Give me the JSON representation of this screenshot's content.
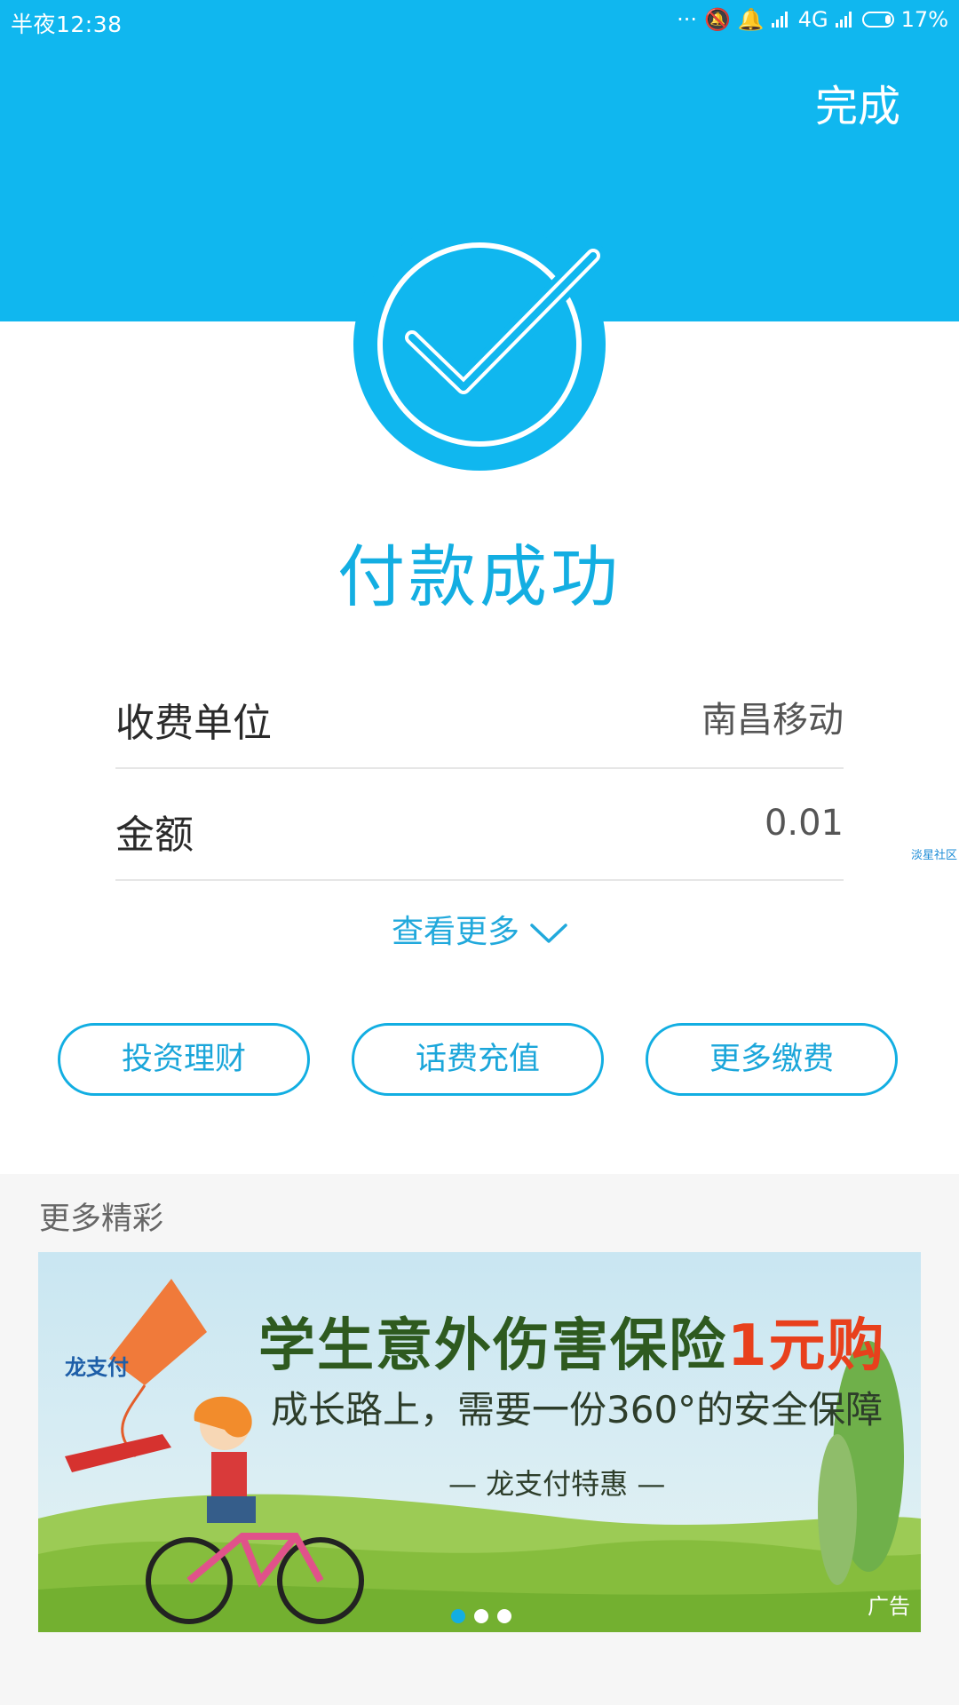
{
  "status_bar": {
    "time": "半夜12:38",
    "network": "4G",
    "battery": "17%"
  },
  "header": {
    "done_label": "完成"
  },
  "result": {
    "title": "付款成功",
    "rows": [
      {
        "label": "收费单位",
        "value": "南昌移动"
      },
      {
        "label": "金额",
        "value": "0.01"
      }
    ],
    "see_more": "查看更多"
  },
  "side_tag": "淡星社区",
  "actions": [
    {
      "label": "投资理财"
    },
    {
      "label": "话费充值"
    },
    {
      "label": "更多缴费"
    }
  ],
  "more": {
    "title": "更多精彩",
    "banner": {
      "logo_text": "龙支付",
      "headline_main": "学生意外伤害保险",
      "headline_accent": "1元购",
      "subtitle": "成长路上，需要一份360°的安全保障",
      "tagline": "— 龙支付特惠 —",
      "ad_label": "广告",
      "pagination_count": 3,
      "active_index": 0
    }
  },
  "colors": {
    "brand_blue": "#10b7ef",
    "accent_blue": "#13aee2",
    "banner_red": "#e8401c"
  }
}
